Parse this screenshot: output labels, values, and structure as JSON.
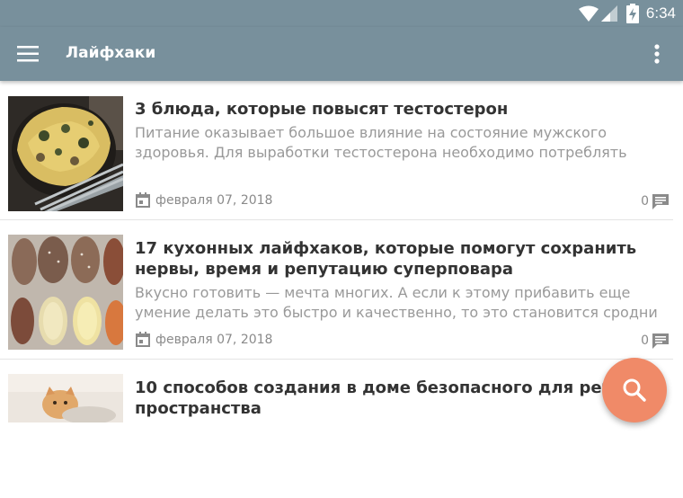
{
  "status_bar": {
    "time": "6:34"
  },
  "toolbar": {
    "title": "Лайфхаки",
    "menu_icon": "hamburger-menu-icon",
    "overflow_icon": "more-vert-icon"
  },
  "articles": [
    {
      "title": "3 блюда, которые повысят тестостерон",
      "excerpt": "Питание оказывает большое влияние на состояние мужского здоровья. Для выработки тестостерона необходимо потреблять",
      "date": "февраля 07, 2018",
      "comments": "0"
    },
    {
      "title": "17 кухонных лайфхаков, которые помогут сохранить нервы, время и репутацию суперповара",
      "excerpt": "Вкусно готовить — мечта многих. А если к этому прибавить еще умение делать это быстро и качественно, то это становится сродни",
      "date": "февраля 07, 2018",
      "comments": "0"
    },
    {
      "title": "10 способов создания в доме безопасного для ребенка пространства",
      "excerpt": "",
      "date": "",
      "comments": ""
    }
  ],
  "fab": {
    "icon": "search-icon",
    "color": "#f08a68"
  },
  "colors": {
    "app_bar": "#78909c",
    "accent": "#f08a68"
  }
}
